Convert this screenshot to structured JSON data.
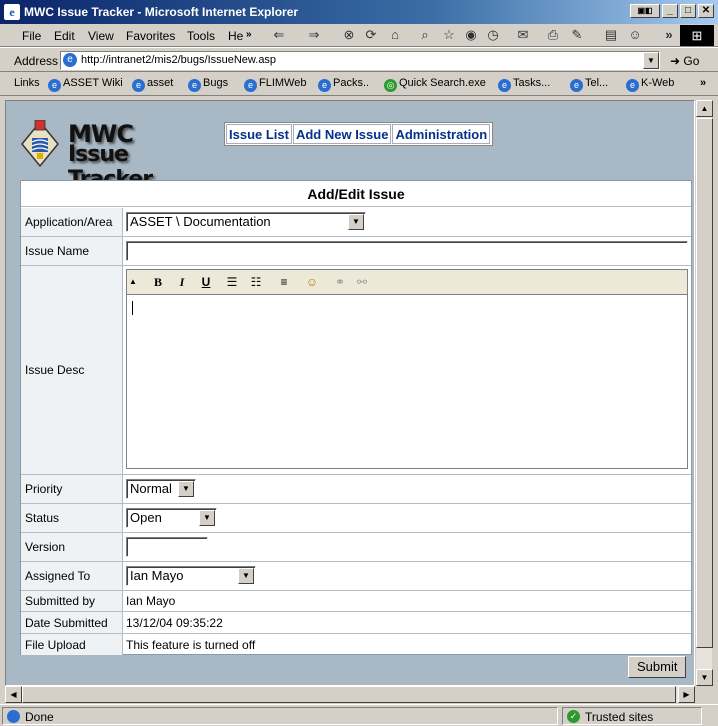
{
  "window": {
    "title": "MWC Issue Tracker - Microsoft Internet Explorer"
  },
  "menu": [
    "File",
    "Edit",
    "View",
    "Favorites",
    "Tools",
    "He"
  ],
  "address": {
    "label": "Address",
    "url": "http://intranet2/mis2/bugs/IssueNew.asp",
    "go": "Go"
  },
  "links": [
    "Links",
    "ASSET Wiki",
    "asset",
    "Bugs",
    "FLIMWeb",
    "Packs..",
    "Quick Search.exe",
    "Tasks...",
    "Tel...",
    "K-Web"
  ],
  "status": {
    "text": "Done",
    "zone": "Trusted sites"
  },
  "app": {
    "logo_line1": "MWC",
    "logo_line2": "Issue Tracker",
    "nav": [
      "Issue List",
      "Add New Issue",
      "Administration"
    ]
  },
  "form": {
    "heading": "Add/Edit Issue",
    "labels": {
      "area": "Application/Area",
      "name": "Issue Name",
      "desc": "Issue Desc",
      "priority": "Priority",
      "status": "Status",
      "version": "Version",
      "assigned": "Assigned To",
      "submitted_by": "Submitted by",
      "date_submitted": "Date Submitted",
      "file_upload": "File Upload"
    },
    "values": {
      "area": "ASSET \\ Documentation",
      "name": "",
      "priority": "Normal",
      "status": "Open",
      "version": "",
      "assigned": "Ian Mayo",
      "submitted_by": "Ian Mayo",
      "date_submitted": "13/12/04 09:35:22",
      "file_upload": "This feature is turned off"
    },
    "submit": "Submit"
  }
}
